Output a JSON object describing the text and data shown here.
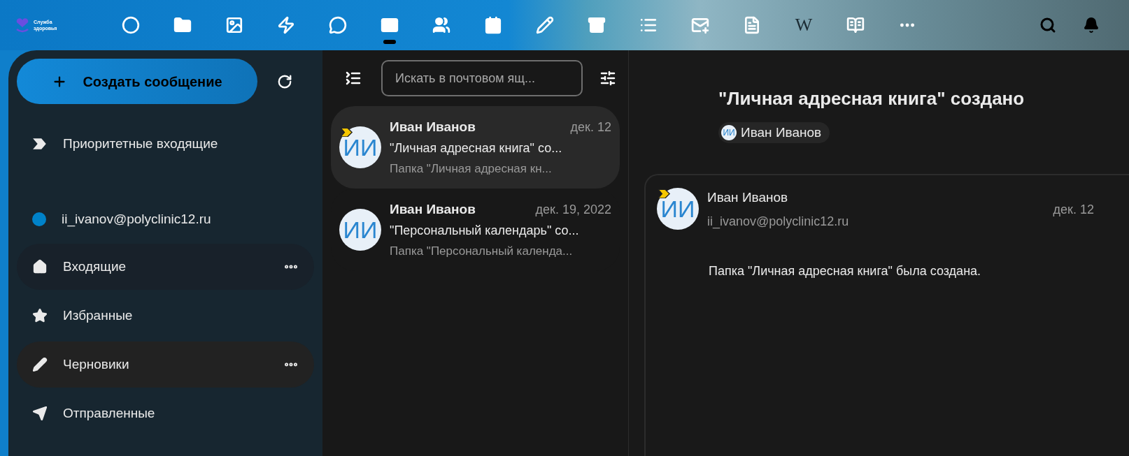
{
  "logo": {
    "lines": [
      "Служба",
      "здоровья"
    ]
  },
  "apps": [
    {
      "selected": false
    },
    {
      "selected": false
    },
    {
      "selected": false
    },
    {
      "selected": false
    },
    {
      "selected": false
    },
    {
      "selected": true
    },
    {
      "selected": false
    },
    {
      "selected": false
    },
    {
      "selected": false
    },
    {
      "selected": false
    },
    {
      "selected": false
    },
    {
      "selected": false
    },
    {
      "selected": false
    },
    {
      "selected": false,
      "glyph": "W"
    },
    {
      "selected": false
    },
    {
      "selected": false
    }
  ],
  "sidebar": {
    "new_message": "Создать сообщение",
    "items": [
      {
        "kind": "folder",
        "label": "Приоритетные входящие",
        "selected": false,
        "hovered": false
      },
      {
        "kind": "account",
        "label": "ii_ivanov@polyclinic12.ru",
        "color": "#0082c9"
      },
      {
        "kind": "folder",
        "label": "Входящие",
        "selected": true,
        "hovered": false
      },
      {
        "kind": "folder",
        "label": "Избранные",
        "selected": false,
        "hovered": false
      },
      {
        "kind": "folder",
        "label": "Черновики",
        "selected": false,
        "hovered": true
      },
      {
        "kind": "folder",
        "label": "Отправленные",
        "selected": false,
        "hovered": false
      }
    ]
  },
  "message_list": {
    "search": {
      "placeholder": "Искать в почтовом ящ..."
    },
    "messages": [
      {
        "initials": "ИИ",
        "sender": "Иван Иванов",
        "date": "дек. 12",
        "subject": "\"Личная адресная книга\" со...",
        "preview": "Папка \"Личная адресная кн...",
        "important": true,
        "selected": true
      },
      {
        "initials": "ИИ",
        "sender": "Иван Иванов",
        "date": "дек. 19, 2022",
        "subject": "\"Персональный календарь\" со...",
        "preview": "Папка \"Персональный календа...",
        "important": false,
        "selected": false
      }
    ]
  },
  "reader": {
    "subject": "\"Личная адресная книга\" создано",
    "participant": {
      "initials": "ИИ",
      "name": "Иван Иванов"
    },
    "message": {
      "initials": "ИИ",
      "important": true,
      "sender": "Иван Иванов",
      "address": "ii_ivanov@polyclinic12.ru",
      "date": "дек. 12",
      "body": "Папка \"Личная адресная книга\" была создана."
    }
  }
}
